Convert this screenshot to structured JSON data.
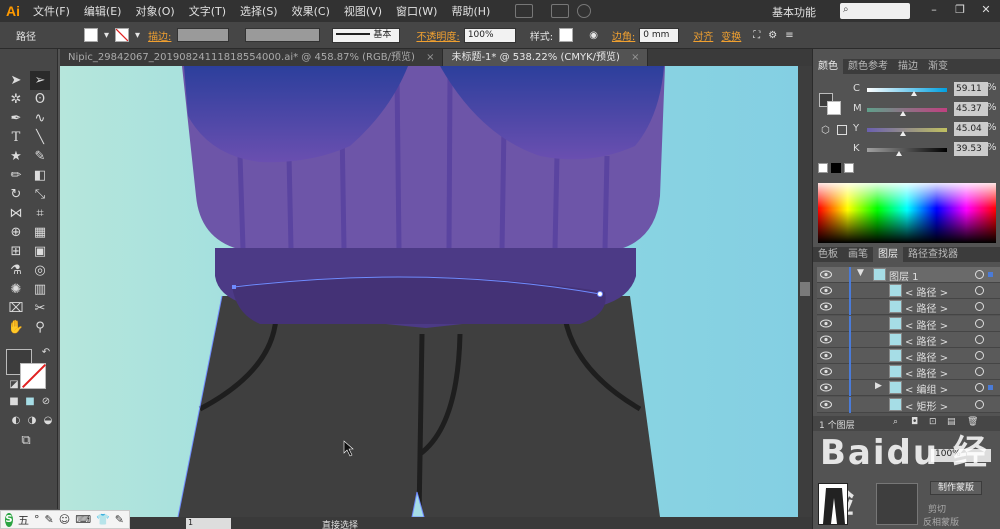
{
  "app": {
    "logo": "Ai"
  },
  "menu": [
    "文件(F)",
    "编辑(E)",
    "对象(O)",
    "文字(T)",
    "选择(S)",
    "效果(C)",
    "视图(V)",
    "窗口(W)",
    "帮助(H)"
  ],
  "workspace": "基本功能",
  "control": {
    "selection_label": "路径",
    "stroke_label": "描边:",
    "brush_label": "基本",
    "opacity_label": "不透明度:",
    "opacity_value": "100%",
    "style_label": "样式:",
    "corner_label": "边角:",
    "corner_value": "0 mm",
    "align_label": "对齐",
    "transform_label": "变换"
  },
  "tabs": [
    {
      "label": "Nipic_29842067_20190824111818554000.ai* @ 458.87% (RGB/预览)",
      "close": "×"
    },
    {
      "label": "未标题-1* @ 538.22% (CMYK/预览)",
      "close": "×"
    }
  ],
  "status": {
    "zoom": "1",
    "tool": "直接选择"
  },
  "ime": [
    "五",
    "°",
    "✎",
    "☺",
    "⌨",
    "👕",
    "✎"
  ],
  "color_panel": {
    "tabs": [
      "颜色",
      "颜色参考",
      "描边",
      "渐变"
    ],
    "channels": [
      {
        "label": "C",
        "value": "59.11",
        "pct": "%",
        "level": 0.59,
        "grad": "linear-gradient(to right,#ffffff,#00a0e0)"
      },
      {
        "label": "M",
        "value": "45.37",
        "pct": "%",
        "level": 0.45,
        "grad": "linear-gradient(to right,#5fa08a,#c04080)"
      },
      {
        "label": "Y",
        "value": "45.04",
        "pct": "%",
        "level": 0.45,
        "grad": "linear-gradient(to right,#6a5fb0,#c0c060)"
      },
      {
        "label": "K",
        "value": "39.53",
        "pct": "%",
        "level": 0.4,
        "grad": "linear-gradient(to right,#a0a0a0,#000000)"
      }
    ]
  },
  "layers_panel": {
    "tabs": [
      "色板",
      "画笔",
      "图层",
      "路径查找器"
    ],
    "rows": [
      {
        "name": "图层 1",
        "indent": 0
      },
      {
        "name": "< 路径 >",
        "indent": 1
      },
      {
        "name": "< 路径 >",
        "indent": 1
      },
      {
        "name": "< 路径 >",
        "indent": 1
      },
      {
        "name": "< 路径 >",
        "indent": 1
      },
      {
        "name": "< 路径 >",
        "indent": 1
      },
      {
        "name": "< 路径 >",
        "indent": 1
      },
      {
        "name": "< 编组 >",
        "indent": 1
      },
      {
        "name": "< 矩形 >",
        "indent": 1
      }
    ],
    "footer": "1 个图层"
  },
  "watermark": "Baidu 经验",
  "transparency": {
    "opacity": "100%",
    "make_mask": "制作蒙版",
    "clip": "剪切",
    "invert": "反相蒙版"
  },
  "colors": {
    "sky": "#7fd0e2",
    "sweater": "#6b54a6",
    "band": "#4c3a86",
    "pants": "#3f3f3f"
  }
}
